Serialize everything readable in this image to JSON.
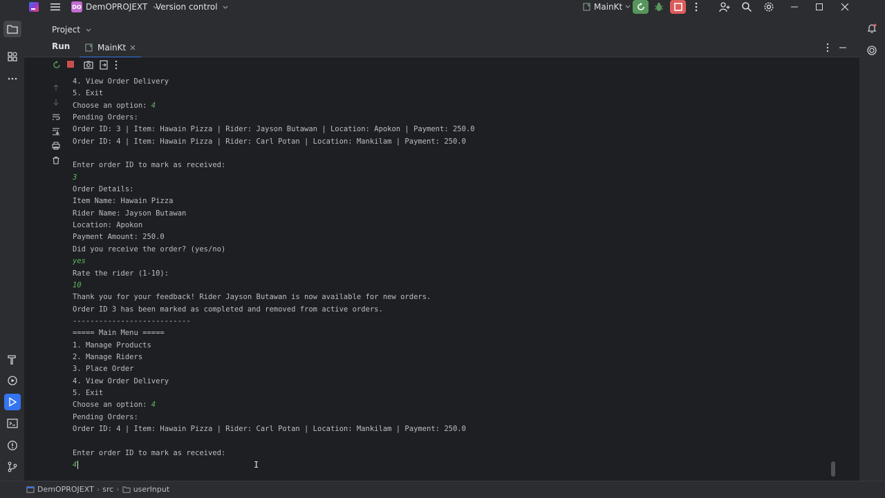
{
  "title_bar": {
    "project_badge": "DO",
    "project_name": "DemOPROJEXT",
    "version_control": "Version control",
    "run_config": "MainKt"
  },
  "tool_window": {
    "project_label": "Project",
    "run_label": "Run",
    "tab_label": "MainKt"
  },
  "console": {
    "lines": [
      {
        "text": "4. View Order Delivery",
        "type": "output"
      },
      {
        "text": "5. Exit",
        "type": "output"
      },
      {
        "text": "Choose an option: ",
        "type": "output",
        "input": "4"
      },
      {
        "text": "Pending Orders:",
        "type": "output"
      },
      {
        "text": "Order ID: 3 | Item: Hawain Pizza | Rider: Jayson Butawan | Location: Apokon | Payment: 250.0",
        "type": "output"
      },
      {
        "text": "Order ID: 4 | Item: Hawain Pizza | Rider: Carl Potan | Location: Mankilam | Payment: 250.0",
        "type": "output"
      },
      {
        "text": "",
        "type": "output"
      },
      {
        "text": "Enter order ID to mark as received:",
        "type": "output"
      },
      {
        "text": "3",
        "type": "input"
      },
      {
        "text": "Order Details:",
        "type": "output"
      },
      {
        "text": "Item Name: Hawain Pizza",
        "type": "output"
      },
      {
        "text": "Rider Name: Jayson Butawan",
        "type": "output"
      },
      {
        "text": "Location: Apokon",
        "type": "output"
      },
      {
        "text": "Payment Amount: 250.0",
        "type": "output"
      },
      {
        "text": "Did you receive the order? (yes/no)",
        "type": "output"
      },
      {
        "text": "yes",
        "type": "input"
      },
      {
        "text": "Rate the rider (1-10):",
        "type": "output"
      },
      {
        "text": "10",
        "type": "input"
      },
      {
        "text": "Thank you for your feedback! Rider Jayson Butawan is now available for new orders.",
        "type": "output"
      },
      {
        "text": "Order ID 3 has been marked as completed and removed from active orders.",
        "type": "output"
      },
      {
        "text": "---------------------------",
        "type": "output"
      },
      {
        "text": "===== Main Menu =====",
        "type": "output"
      },
      {
        "text": "1. Manage Products",
        "type": "output"
      },
      {
        "text": "2. Manage Riders",
        "type": "output"
      },
      {
        "text": "3. Place Order",
        "type": "output"
      },
      {
        "text": "4. View Order Delivery",
        "type": "output"
      },
      {
        "text": "5. Exit",
        "type": "output"
      },
      {
        "text": "Choose an option: ",
        "type": "output",
        "input": "4"
      },
      {
        "text": "Pending Orders:",
        "type": "output"
      },
      {
        "text": "Order ID: 4 | Item: Hawain Pizza | Rider: Carl Potan | Location: Mankilam | Payment: 250.0",
        "type": "output"
      },
      {
        "text": "",
        "type": "output"
      },
      {
        "text": "Enter order ID to mark as received:",
        "type": "output"
      },
      {
        "text": "4",
        "type": "input",
        "cursor": true
      }
    ]
  },
  "status_bar": {
    "breadcrumb": [
      "DemOPROJEXT",
      "src",
      "userInput"
    ]
  },
  "colors": {
    "accent": "#3574f0",
    "run_green": "#57965c",
    "stop_red": "#db5c5c",
    "input_green": "#5fb760",
    "badge_purple": "#c36dd0"
  }
}
